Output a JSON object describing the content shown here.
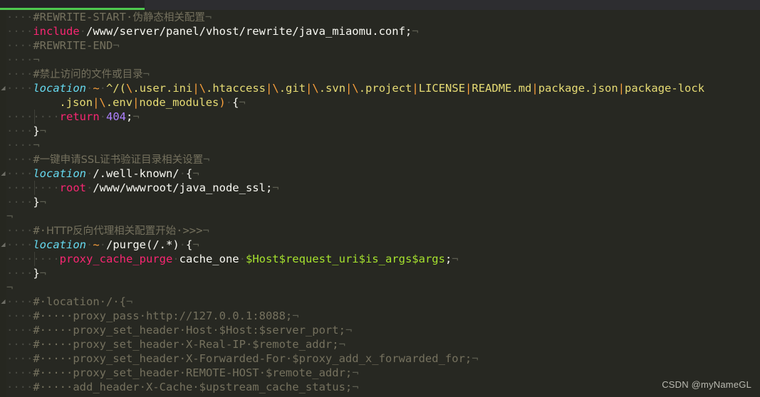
{
  "window": {
    "theme_background": "#272822",
    "top_bar_background": "#2d2d30",
    "progress_accent": "#4ec94e",
    "progress_percent": 19
  },
  "palette": {
    "comment": "#75715e",
    "keyword": "#f92672",
    "location": "#66d9ef",
    "string": "#e6db74",
    "operator": "#f9a03c",
    "number": "#ae81ff",
    "variable": "#a6e22e",
    "plain": "#f8f8f2",
    "whitespace_marker": "#4a4b43",
    "eol_marker": "#5c5d50"
  },
  "markers": {
    "space_dot": "·",
    "eol": "¬",
    "fold_collapse": "◢"
  },
  "editor": {
    "language": "nginx",
    "lines": [
      {
        "fold": false,
        "indent_guide": false,
        "tokens": [
          {
            "c": "ws",
            "t": "····"
          },
          {
            "c": "cmt",
            "t": "#REWRITE-START"
          },
          {
            "c": "cmt",
            "t": "·"
          },
          {
            "c": "cmt cn",
            "t": "伪静态相关配置"
          },
          {
            "c": "eol",
            "t": "¬"
          }
        ]
      },
      {
        "fold": false,
        "indent_guide": false,
        "tokens": [
          {
            "c": "ws",
            "t": "····"
          },
          {
            "c": "kw",
            "t": "include"
          },
          {
            "c": "ws",
            "t": "·"
          },
          {
            "c": "plain",
            "t": "/www/server/panel/vhost/rewrite/java_miaomu.conf;"
          },
          {
            "c": "eol",
            "t": "¬"
          }
        ]
      },
      {
        "fold": false,
        "indent_guide": false,
        "tokens": [
          {
            "c": "ws",
            "t": "····"
          },
          {
            "c": "cmt",
            "t": "#REWRITE-END"
          },
          {
            "c": "eol",
            "t": "¬"
          }
        ]
      },
      {
        "fold": false,
        "indent_guide": false,
        "tokens": [
          {
            "c": "ws",
            "t": "····"
          },
          {
            "c": "eol",
            "t": "¬"
          }
        ]
      },
      {
        "fold": false,
        "indent_guide": false,
        "tokens": [
          {
            "c": "ws",
            "t": "····"
          },
          {
            "c": "cmt",
            "t": "#"
          },
          {
            "c": "cmt cn",
            "t": "禁止访问的文件或目录"
          },
          {
            "c": "eol",
            "t": "¬"
          }
        ]
      },
      {
        "fold": true,
        "indent_guide": false,
        "tokens": [
          {
            "c": "ws",
            "t": "····"
          },
          {
            "c": "loc",
            "t": "location"
          },
          {
            "c": "ws",
            "t": "·"
          },
          {
            "c": "op",
            "t": "~"
          },
          {
            "c": "ws",
            "t": "·"
          },
          {
            "c": "str",
            "t": "^/("
          },
          {
            "c": "op",
            "t": "\\"
          },
          {
            "c": "str",
            "t": ".user.ini"
          },
          {
            "c": "op",
            "t": "|\\"
          },
          {
            "c": "str",
            "t": ".htaccess"
          },
          {
            "c": "op",
            "t": "|\\"
          },
          {
            "c": "str",
            "t": ".git"
          },
          {
            "c": "op",
            "t": "|\\"
          },
          {
            "c": "str",
            "t": ".svn"
          },
          {
            "c": "op",
            "t": "|\\"
          },
          {
            "c": "str",
            "t": ".project"
          },
          {
            "c": "op",
            "t": "|"
          },
          {
            "c": "str",
            "t": "LICENSE"
          },
          {
            "c": "op",
            "t": "|"
          },
          {
            "c": "str",
            "t": "README.md"
          },
          {
            "c": "op",
            "t": "|"
          },
          {
            "c": "str",
            "t": "package.json"
          },
          {
            "c": "op",
            "t": "|"
          },
          {
            "c": "str",
            "t": "package-lock"
          }
        ]
      },
      {
        "fold": false,
        "indent_guide": false,
        "wrapped": true,
        "tokens": [
          {
            "c": "str",
            "t": ".json"
          },
          {
            "c": "op",
            "t": "|\\"
          },
          {
            "c": "str",
            "t": ".env"
          },
          {
            "c": "op",
            "t": "|"
          },
          {
            "c": "str",
            "t": "node_modules"
          },
          {
            "c": "op",
            "t": ")"
          },
          {
            "c": "ws",
            "t": "·"
          },
          {
            "c": "plain",
            "t": "{"
          },
          {
            "c": "eol",
            "t": "¬"
          }
        ]
      },
      {
        "fold": false,
        "indent_guide": true,
        "tokens": [
          {
            "c": "ws",
            "t": "····"
          },
          {
            "c": "ws",
            "t": "····"
          },
          {
            "c": "kw",
            "t": "return"
          },
          {
            "c": "ws",
            "t": "·"
          },
          {
            "c": "num",
            "t": "404"
          },
          {
            "c": "plain",
            "t": ";"
          },
          {
            "c": "eol",
            "t": "¬"
          }
        ]
      },
      {
        "fold": false,
        "indent_guide": false,
        "tokens": [
          {
            "c": "ws",
            "t": "····"
          },
          {
            "c": "plain",
            "t": "}"
          },
          {
            "c": "eol",
            "t": "¬"
          }
        ]
      },
      {
        "fold": false,
        "indent_guide": false,
        "tokens": [
          {
            "c": "ws",
            "t": "····"
          },
          {
            "c": "eol",
            "t": "¬"
          }
        ]
      },
      {
        "fold": false,
        "indent_guide": false,
        "tokens": [
          {
            "c": "ws",
            "t": "····"
          },
          {
            "c": "cmt",
            "t": "#"
          },
          {
            "c": "cmt cn",
            "t": "一键申请SSL证书验证目录相关设置"
          },
          {
            "c": "eol",
            "t": "¬"
          }
        ]
      },
      {
        "fold": true,
        "indent_guide": false,
        "tokens": [
          {
            "c": "ws",
            "t": "····"
          },
          {
            "c": "loc",
            "t": "location"
          },
          {
            "c": "ws",
            "t": "·"
          },
          {
            "c": "plain",
            "t": "/.well-known/"
          },
          {
            "c": "ws",
            "t": "·"
          },
          {
            "c": "plain",
            "t": "{"
          },
          {
            "c": "eol",
            "t": "¬"
          }
        ]
      },
      {
        "fold": false,
        "indent_guide": true,
        "tokens": [
          {
            "c": "ws",
            "t": "····"
          },
          {
            "c": "ws",
            "t": "····"
          },
          {
            "c": "kw",
            "t": "root"
          },
          {
            "c": "ws",
            "t": "·"
          },
          {
            "c": "plain",
            "t": "/www/wwwroot/java_node_ssl;"
          },
          {
            "c": "eol",
            "t": "¬"
          }
        ]
      },
      {
        "fold": false,
        "indent_guide": false,
        "tokens": [
          {
            "c": "ws",
            "t": "····"
          },
          {
            "c": "plain",
            "t": "}"
          },
          {
            "c": "eol",
            "t": "¬"
          }
        ]
      },
      {
        "fold": false,
        "indent_guide": false,
        "tokens": [
          {
            "c": "eol",
            "t": "¬"
          }
        ]
      },
      {
        "fold": false,
        "indent_guide": false,
        "tokens": [
          {
            "c": "ws",
            "t": "····"
          },
          {
            "c": "cmt",
            "t": "#"
          },
          {
            "c": "cmt",
            "t": "·"
          },
          {
            "c": "cmt cn",
            "t": "HTTP反向代理相关配置开始"
          },
          {
            "c": "cmt",
            "t": "·>>>"
          },
          {
            "c": "eol",
            "t": "¬"
          }
        ]
      },
      {
        "fold": true,
        "indent_guide": false,
        "tokens": [
          {
            "c": "ws",
            "t": "····"
          },
          {
            "c": "loc",
            "t": "location"
          },
          {
            "c": "ws",
            "t": "·"
          },
          {
            "c": "op",
            "t": "~"
          },
          {
            "c": "ws",
            "t": "·"
          },
          {
            "c": "plain",
            "t": "/purge(/.*)"
          },
          {
            "c": "ws",
            "t": "·"
          },
          {
            "c": "plain",
            "t": "{"
          },
          {
            "c": "eol",
            "t": "¬"
          }
        ]
      },
      {
        "fold": false,
        "indent_guide": true,
        "tokens": [
          {
            "c": "ws",
            "t": "····"
          },
          {
            "c": "ws",
            "t": "····"
          },
          {
            "c": "kw",
            "t": "proxy_cache_purge"
          },
          {
            "c": "ws",
            "t": "·"
          },
          {
            "c": "plain",
            "t": "cache_one"
          },
          {
            "c": "ws",
            "t": "·"
          },
          {
            "c": "var",
            "t": "$Host$request_uri$is_args$args"
          },
          {
            "c": "plain",
            "t": ";"
          },
          {
            "c": "eol",
            "t": "¬"
          }
        ]
      },
      {
        "fold": false,
        "indent_guide": false,
        "tokens": [
          {
            "c": "ws",
            "t": "····"
          },
          {
            "c": "plain",
            "t": "}"
          },
          {
            "c": "eol",
            "t": "¬"
          }
        ]
      },
      {
        "fold": false,
        "indent_guide": false,
        "tokens": [
          {
            "c": "eol",
            "t": "¬"
          }
        ]
      },
      {
        "fold": true,
        "indent_guide": false,
        "tokens": [
          {
            "c": "ws",
            "t": "····"
          },
          {
            "c": "cmt",
            "t": "#·location·/·{"
          },
          {
            "c": "eol",
            "t": "¬"
          }
        ]
      },
      {
        "fold": false,
        "indent_guide": false,
        "tokens": [
          {
            "c": "ws",
            "t": "····"
          },
          {
            "c": "cmt",
            "t": "#·····proxy_pass·http://127.0.0.1:8088;"
          },
          {
            "c": "eol",
            "t": "¬"
          }
        ]
      },
      {
        "fold": false,
        "indent_guide": false,
        "tokens": [
          {
            "c": "ws",
            "t": "····"
          },
          {
            "c": "cmt",
            "t": "#·····proxy_set_header·Host·$Host:$server_port;"
          },
          {
            "c": "eol",
            "t": "¬"
          }
        ]
      },
      {
        "fold": false,
        "indent_guide": false,
        "tokens": [
          {
            "c": "ws",
            "t": "····"
          },
          {
            "c": "cmt",
            "t": "#·····proxy_set_header·X-Real-IP·$remote_addr;"
          },
          {
            "c": "eol",
            "t": "¬"
          }
        ]
      },
      {
        "fold": false,
        "indent_guide": false,
        "tokens": [
          {
            "c": "ws",
            "t": "····"
          },
          {
            "c": "cmt",
            "t": "#·····proxy_set_header·X-Forwarded-For·$proxy_add_x_forwarded_for;"
          },
          {
            "c": "eol",
            "t": "¬"
          }
        ]
      },
      {
        "fold": false,
        "indent_guide": false,
        "tokens": [
          {
            "c": "ws",
            "t": "····"
          },
          {
            "c": "cmt",
            "t": "#·····proxy_set_header·REMOTE-HOST·$remote_addr;"
          },
          {
            "c": "eol",
            "t": "¬"
          }
        ]
      },
      {
        "fold": false,
        "indent_guide": false,
        "tokens": [
          {
            "c": "ws",
            "t": "····"
          },
          {
            "c": "cmt",
            "t": "#·····add_header·X-Cache·$upstream_cache_status;"
          },
          {
            "c": "eol",
            "t": "¬"
          }
        ]
      }
    ]
  },
  "watermark": {
    "text": "CSDN @myNameGL"
  }
}
